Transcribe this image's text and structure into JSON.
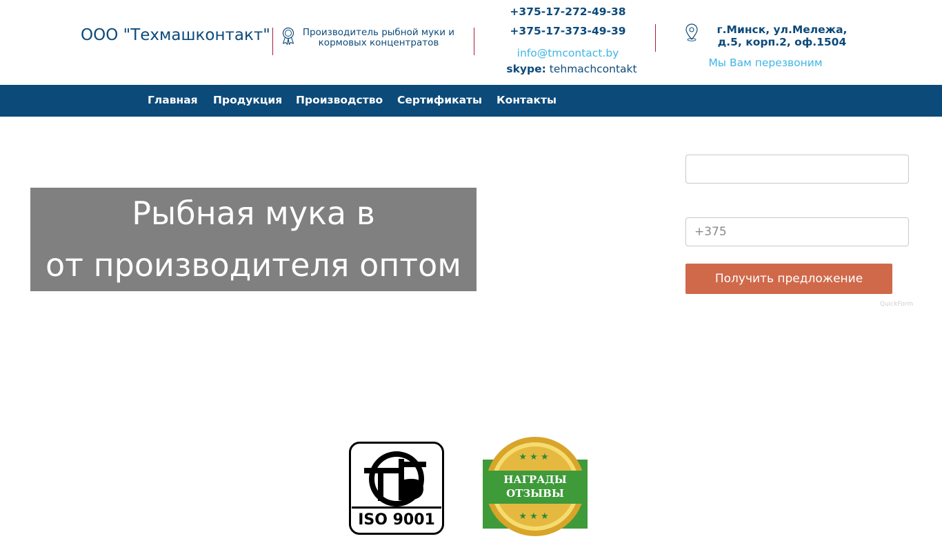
{
  "header": {
    "company": "ООО \"Техмашконтакт\"",
    "tagline": "Производитель рыбной муки и кормовых концентратов",
    "phone1": "+375-17-272-49-38",
    "phone2": "+375-17-373-49-39",
    "email": "info@tmcontact.by",
    "skype_label": "skype:",
    "skype_value": "tehmachcontakt",
    "address": "г.Минск, ул.Мележа, д.5, корп.2, оф.1504",
    "callback": "Мы Вам перезвоним"
  },
  "nav": {
    "items": [
      {
        "label": "Главная"
      },
      {
        "label": "Продукция"
      },
      {
        "label": "Производство"
      },
      {
        "label": "Сертификаты"
      },
      {
        "label": "Контакты"
      }
    ]
  },
  "hero": {
    "line1": "Рыбная мука в",
    "line2": "от производителя оптом"
  },
  "form": {
    "name_value": "",
    "phone_placeholder": "+375",
    "submit_label": "Получить предложение",
    "brand": "QuickForm"
  },
  "badges": {
    "iso_text": "ISO 9001",
    "awards_line1": "НАГРАДЫ",
    "awards_line2": "ОТЗЫВЫ"
  },
  "colors": {
    "brand_blue": "#0c4a7a",
    "accent_light_blue": "#3fb5e6",
    "divider_red": "#a31e3a",
    "button_orange": "#d0694a",
    "hero_grey": "#808080"
  },
  "icons": {
    "tagline": "award-ribbon-icon",
    "address": "map-pin-icon"
  }
}
